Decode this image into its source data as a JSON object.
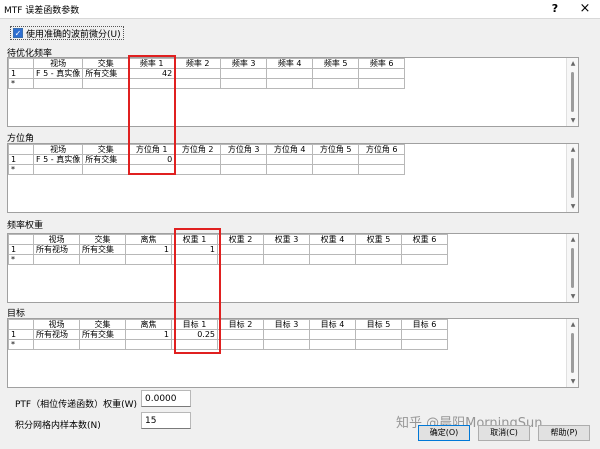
{
  "window": {
    "title": "MTF 误差函数参数",
    "help_glyph": "?",
    "close_glyph": "×"
  },
  "checkbox": {
    "label": "使用准确的波前微分(U)",
    "checked": "✓"
  },
  "sections": {
    "freq": {
      "label": "待优化频率",
      "headers": [
        "",
        "视场",
        "交集",
        "频率 1",
        "频率 2",
        "频率 3",
        "频率 4",
        "频率 5",
        "频率 6"
      ],
      "row1": [
        "1",
        "F 5 - 真实像",
        "所有交集",
        "42",
        "",
        "",
        "",
        "",
        ""
      ],
      "row2": [
        "*",
        "",
        "",
        "",
        "",
        "",
        "",
        "",
        ""
      ]
    },
    "azimuth": {
      "label": "方位角",
      "headers": [
        "",
        "视场",
        "交集",
        "方位角 1",
        "方位角 2",
        "方位角 3",
        "方位角 4",
        "方位角 5",
        "方位角 6"
      ],
      "row1": [
        "1",
        "F 5 - 真实像",
        "所有交集",
        "0",
        "",
        "",
        "",
        "",
        ""
      ],
      "row2": [
        "*",
        "",
        "",
        "",
        "",
        "",
        "",
        "",
        ""
      ]
    },
    "weight": {
      "label": "频率权重",
      "headers": [
        "",
        "视场",
        "交集",
        "离焦",
        "权重 1",
        "权重 2",
        "权重 3",
        "权重 4",
        "权重 5",
        "权重 6"
      ],
      "row1": [
        "1",
        "所有视场",
        "所有交集",
        "1",
        "1",
        "",
        "",
        "",
        "",
        ""
      ],
      "row2": [
        "*",
        "",
        "",
        "",
        "",
        "",
        "",
        "",
        "",
        ""
      ]
    },
    "target": {
      "label": "目标",
      "headers": [
        "",
        "视场",
        "交集",
        "离焦",
        "目标 1",
        "目标 2",
        "目标 3",
        "目标 4",
        "目标 5",
        "目标 6"
      ],
      "row1": [
        "1",
        "所有视场",
        "所有交集",
        "1",
        "0.25",
        "",
        "",
        "",
        "",
        ""
      ],
      "row2": [
        "*",
        "",
        "",
        "",
        "",
        "",
        "",
        "",
        "",
        ""
      ]
    }
  },
  "bottom": {
    "ptf_label": "PTF（相位传递函数）权重(W)",
    "ptf_value": "0.0000",
    "samples_label": "积分网格内样本数(N)",
    "samples_value": "15"
  },
  "buttons": {
    "ok": "确定(O)",
    "cancel": "取消(C)",
    "help": "帮助(P)"
  },
  "watermark": "知乎 @晨阳MorningSun",
  "colors": {
    "highlight": "#e02020",
    "accent": "#0078d7"
  }
}
